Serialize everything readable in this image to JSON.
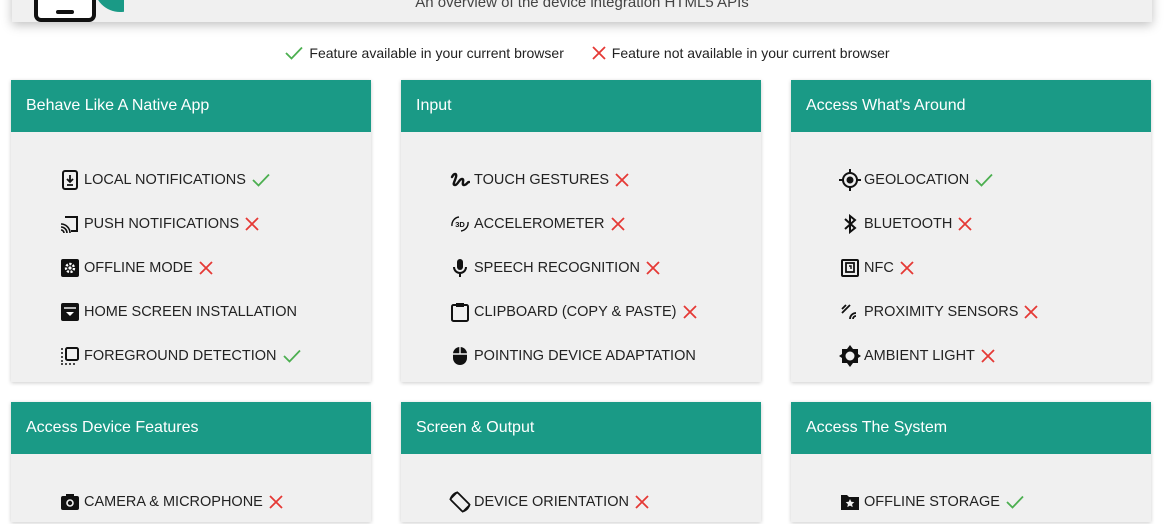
{
  "header": {
    "subtitle": "An overview of the device integration HTML5 APIs"
  },
  "legend": {
    "available": "Feature available in your current browser",
    "unavailable": "Feature not available in your current browser"
  },
  "colors": {
    "accent": "#1a9a86",
    "available": "#4caf50",
    "unavailable": "#e53935"
  },
  "cards": [
    {
      "title": "Behave Like A Native App",
      "features": [
        {
          "label": "LOCAL NOTIFICATIONS",
          "icon": "phone-download-icon",
          "status": "available"
        },
        {
          "label": "PUSH NOTIFICATIONS",
          "icon": "cast-icon",
          "status": "unavailable"
        },
        {
          "label": "OFFLINE MODE",
          "icon": "gear-box-icon",
          "status": "unavailable"
        },
        {
          "label": "HOME SCREEN INSTALLATION",
          "icon": "install-box-icon",
          "status": "none"
        },
        {
          "label": "FOREGROUND DETECTION",
          "icon": "foreground-icon",
          "status": "available"
        }
      ]
    },
    {
      "title": "Input",
      "features": [
        {
          "label": "TOUCH GESTURES",
          "icon": "gesture-icon",
          "status": "unavailable"
        },
        {
          "label": "ACCELEROMETER",
          "icon": "rotate-3d-icon",
          "status": "unavailable"
        },
        {
          "label": "SPEECH RECOGNITION",
          "icon": "microphone-icon",
          "status": "unavailable"
        },
        {
          "label": "CLIPBOARD (COPY & PASTE)",
          "icon": "clipboard-icon",
          "status": "unavailable"
        },
        {
          "label": "POINTING DEVICE ADAPTATION",
          "icon": "mouse-icon",
          "status": "none"
        }
      ]
    },
    {
      "title": "Access What's Around",
      "features": [
        {
          "label": "GEOLOCATION",
          "icon": "crosshair-icon",
          "status": "available"
        },
        {
          "label": "BLUETOOTH",
          "icon": "bluetooth-icon",
          "status": "unavailable"
        },
        {
          "label": "NFC",
          "icon": "nfc-icon",
          "status": "unavailable"
        },
        {
          "label": "PROXIMITY SENSORS",
          "icon": "proximity-icon",
          "status": "unavailable"
        },
        {
          "label": "AMBIENT LIGHT",
          "icon": "brightness-icon",
          "status": "unavailable"
        }
      ]
    },
    {
      "title": "Access Device Features",
      "features": [
        {
          "label": "CAMERA & MICROPHONE",
          "icon": "camera-icon",
          "status": "unavailable"
        }
      ]
    },
    {
      "title": "Screen & Output",
      "features": [
        {
          "label": "DEVICE ORIENTATION",
          "icon": "screen-rotation-icon",
          "status": "unavailable"
        }
      ]
    },
    {
      "title": "Access The System",
      "features": [
        {
          "label": "OFFLINE STORAGE",
          "icon": "star-folder-icon",
          "status": "available"
        }
      ]
    }
  ]
}
